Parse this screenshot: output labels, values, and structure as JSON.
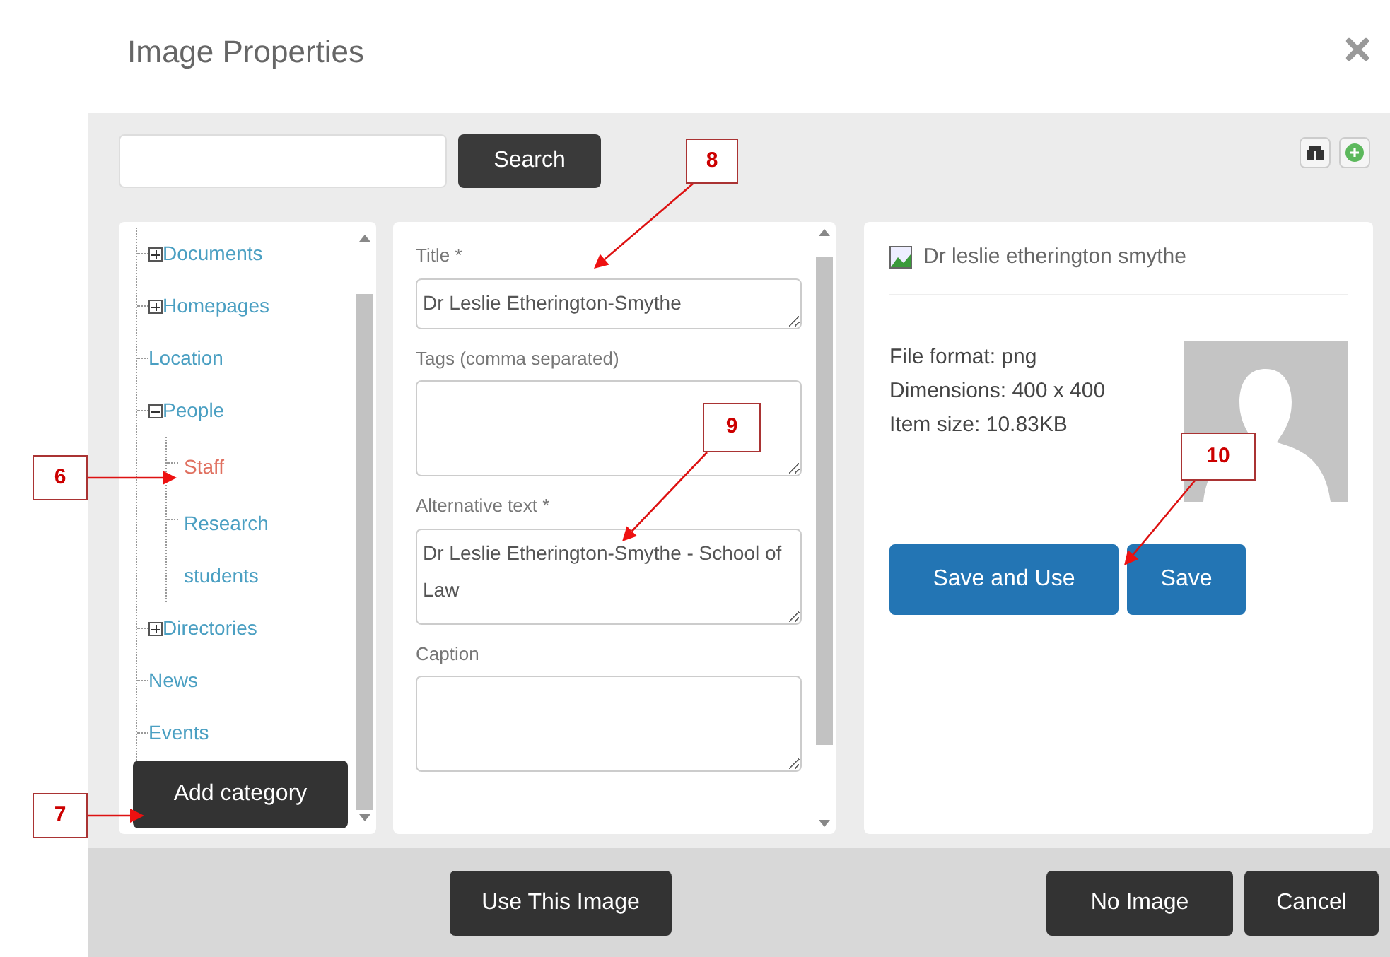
{
  "dialog": {
    "title": "Image Properties"
  },
  "search": {
    "button": "Search"
  },
  "tree": {
    "items": [
      {
        "label": "Documents",
        "expanded": false,
        "selected": false
      },
      {
        "label": "Homepages",
        "expanded": false,
        "selected": false
      },
      {
        "label": "Location",
        "selected": false
      },
      {
        "label": "People",
        "expanded": true,
        "selected": false,
        "children": [
          {
            "label": "Staff",
            "selected": true
          },
          {
            "label": "Research students",
            "selected": false
          }
        ]
      },
      {
        "label": "Directories",
        "expanded": false,
        "selected": false
      },
      {
        "label": "News",
        "selected": false
      },
      {
        "label": "Events",
        "selected": false
      }
    ],
    "add_button": "Add category"
  },
  "form": {
    "fields": [
      {
        "label": "Title *",
        "value": "Dr Leslie Etherington-Smythe",
        "kind": "single"
      },
      {
        "label": "Tags (comma separated)",
        "kind": "multi"
      },
      {
        "label": "Alternative text *",
        "value": "Dr Leslie Etherington-Smythe - School of Law",
        "kind": "multi"
      },
      {
        "label": "Caption",
        "kind": "multi"
      }
    ]
  },
  "details": {
    "name": "Dr leslie etherington smythe",
    "info": [
      "File format: png",
      "Dimensions: 400 x 400",
      "Item size: 10.83KB"
    ],
    "buttons": [
      "Save and Use",
      "Save"
    ]
  },
  "footer": {
    "use_button": "Use This Image",
    "no_image_button": "No Image",
    "cancel_button": "Cancel"
  },
  "callouts": [
    {
      "label": "6"
    },
    {
      "label": "7"
    },
    {
      "label": "8"
    },
    {
      "label": "9"
    },
    {
      "label": "10"
    }
  ]
}
